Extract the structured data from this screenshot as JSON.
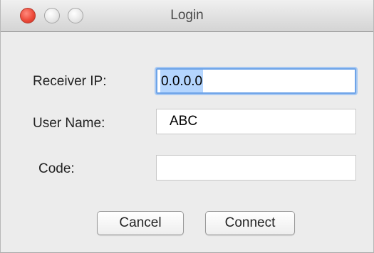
{
  "window": {
    "title": "Login"
  },
  "form": {
    "receiver_ip": {
      "label": "Receiver IP:",
      "value": "0.0.0.0"
    },
    "user_name": {
      "label": "User Name:",
      "value": "ABC"
    },
    "code": {
      "label": "Code:",
      "value": ""
    }
  },
  "buttons": {
    "cancel_label": "Cancel",
    "connect_label": "Connect"
  },
  "colors": {
    "window_bg": "#ececec",
    "focus_ring": "#6ea4e8",
    "selection": "#b4d5fe",
    "close_button": "#ee4b3b"
  }
}
